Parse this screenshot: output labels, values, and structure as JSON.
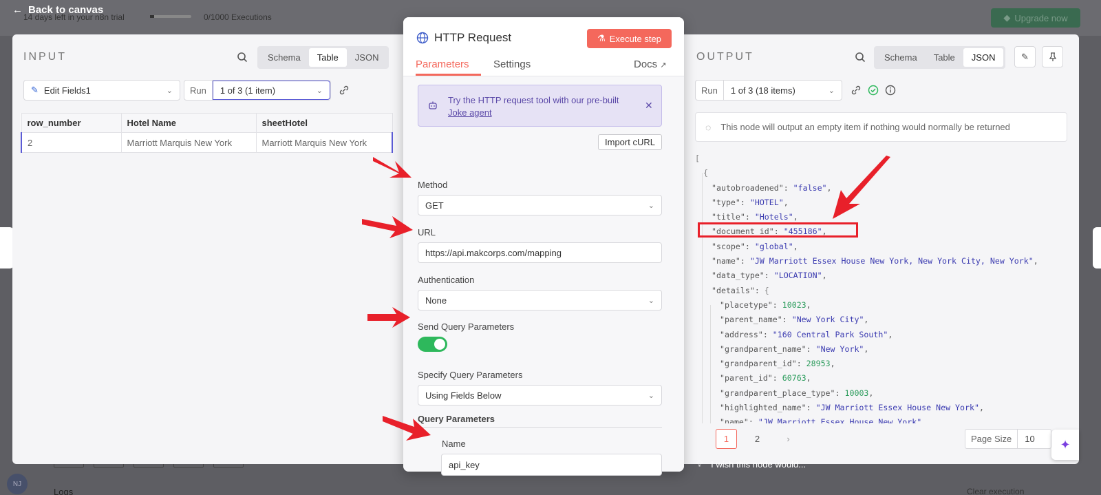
{
  "header": {
    "back_label": "Back to canvas",
    "trial_text": "14 days left in your n8n trial",
    "trial_progress": 0.01,
    "executions": "0/1000 Executions",
    "upgrade_label": "Upgrade now"
  },
  "input": {
    "title": "INPUT",
    "views": [
      "Schema",
      "Table",
      "JSON"
    ],
    "active_view": "Table",
    "source_node": "Edit Fields1",
    "run_label": "Run",
    "run_value": "1 of 3 (1 item)",
    "table": {
      "columns": [
        "row_number",
        "Hotel Name",
        "sheetHotel"
      ],
      "rows": [
        [
          "2",
          "Marriott Marquis New York",
          "Marriott Marquis New York"
        ]
      ]
    }
  },
  "node": {
    "title": "HTTP Request",
    "execute_label": "Execute step",
    "tabs": [
      "Parameters",
      "Settings"
    ],
    "active_tab": "Parameters",
    "docs_label": "Docs",
    "callout_text": "Try the HTTP request tool with our pre-built",
    "callout_link": "Joke agent",
    "import_label": "Import cURL",
    "method_label": "Method",
    "method_value": "GET",
    "url_label": "URL",
    "url_value": "https://api.makcorps.com/mapping",
    "auth_label": "Authentication",
    "auth_value": "None",
    "send_query_label": "Send Query Parameters",
    "send_query_enabled": true,
    "specify_label": "Specify Query Parameters",
    "specify_value": "Using Fields Below",
    "query_params_title": "Query Parameters",
    "param_name_label": "Name",
    "param_name_value": "api_key"
  },
  "output": {
    "title": "OUTPUT",
    "views": [
      "Schema",
      "Table",
      "JSON"
    ],
    "active_view": "JSON",
    "run_label": "Run",
    "run_value": "1 of 3 (18 items)",
    "note": "This node will output an empty item if nothing would normally be returned",
    "json_lines": [
      {
        "indent": 0,
        "punct": "["
      },
      {
        "indent": 1,
        "punct": "{"
      },
      {
        "indent": 2,
        "key": "\"autobroadened\"",
        "val": "\"false\"",
        "type": "s"
      },
      {
        "indent": 2,
        "key": "\"type\"",
        "val": "\"HOTEL\"",
        "type": "s"
      },
      {
        "indent": 2,
        "key": "\"title\"",
        "val": "\"Hotels\"",
        "type": "s"
      },
      {
        "indent": 2,
        "key": "\"document_id\"",
        "val": "\"455186\"",
        "type": "s"
      },
      {
        "indent": 2,
        "key": "\"scope\"",
        "val": "\"global\"",
        "type": "s"
      },
      {
        "indent": 2,
        "key": "\"name\"",
        "val": "\"JW Marriott Essex House New York, New York City, New York\"",
        "type": "s"
      },
      {
        "indent": 2,
        "key": "\"data_type\"",
        "val": "\"LOCATION\"",
        "type": "s"
      },
      {
        "indent": 2,
        "key": "\"details\"",
        "open": "{"
      },
      {
        "indent": 3,
        "key": "\"placetype\"",
        "val": "10023",
        "type": "n"
      },
      {
        "indent": 3,
        "key": "\"parent_name\"",
        "val": "\"New York City\"",
        "type": "s"
      },
      {
        "indent": 3,
        "key": "\"address\"",
        "val": "\"160 Central Park South\"",
        "type": "s"
      },
      {
        "indent": 3,
        "key": "\"grandparent_name\"",
        "val": "\"New York\"",
        "type": "s"
      },
      {
        "indent": 3,
        "key": "\"grandparent_id\"",
        "val": "28953",
        "type": "n"
      },
      {
        "indent": 3,
        "key": "\"parent_id\"",
        "val": "60763",
        "type": "n"
      },
      {
        "indent": 3,
        "key": "\"grandparent_place_type\"",
        "val": "10003",
        "type": "n"
      },
      {
        "indent": 3,
        "key": "\"highlighted_name\"",
        "val": "\"JW Marriott Essex House New York\"",
        "type": "s"
      },
      {
        "indent": 3,
        "key": "\"name\"",
        "val": "\"JW Marriott Essex House New York\"",
        "type": "s",
        "end": "."
      }
    ],
    "pages": [
      "1",
      "2"
    ],
    "active_page": "1",
    "page_size_label": "Page Size",
    "page_size_value": "10"
  },
  "footer": {
    "wish_text": "I wish this node would...",
    "logs_label": "Logs",
    "clear_label": "Clear execution"
  },
  "colors": {
    "accent": "#f4685c",
    "toggle_on": "#2eb85c",
    "annotation_red": "#e8202a",
    "callout_bg": "#e6e2f5"
  }
}
